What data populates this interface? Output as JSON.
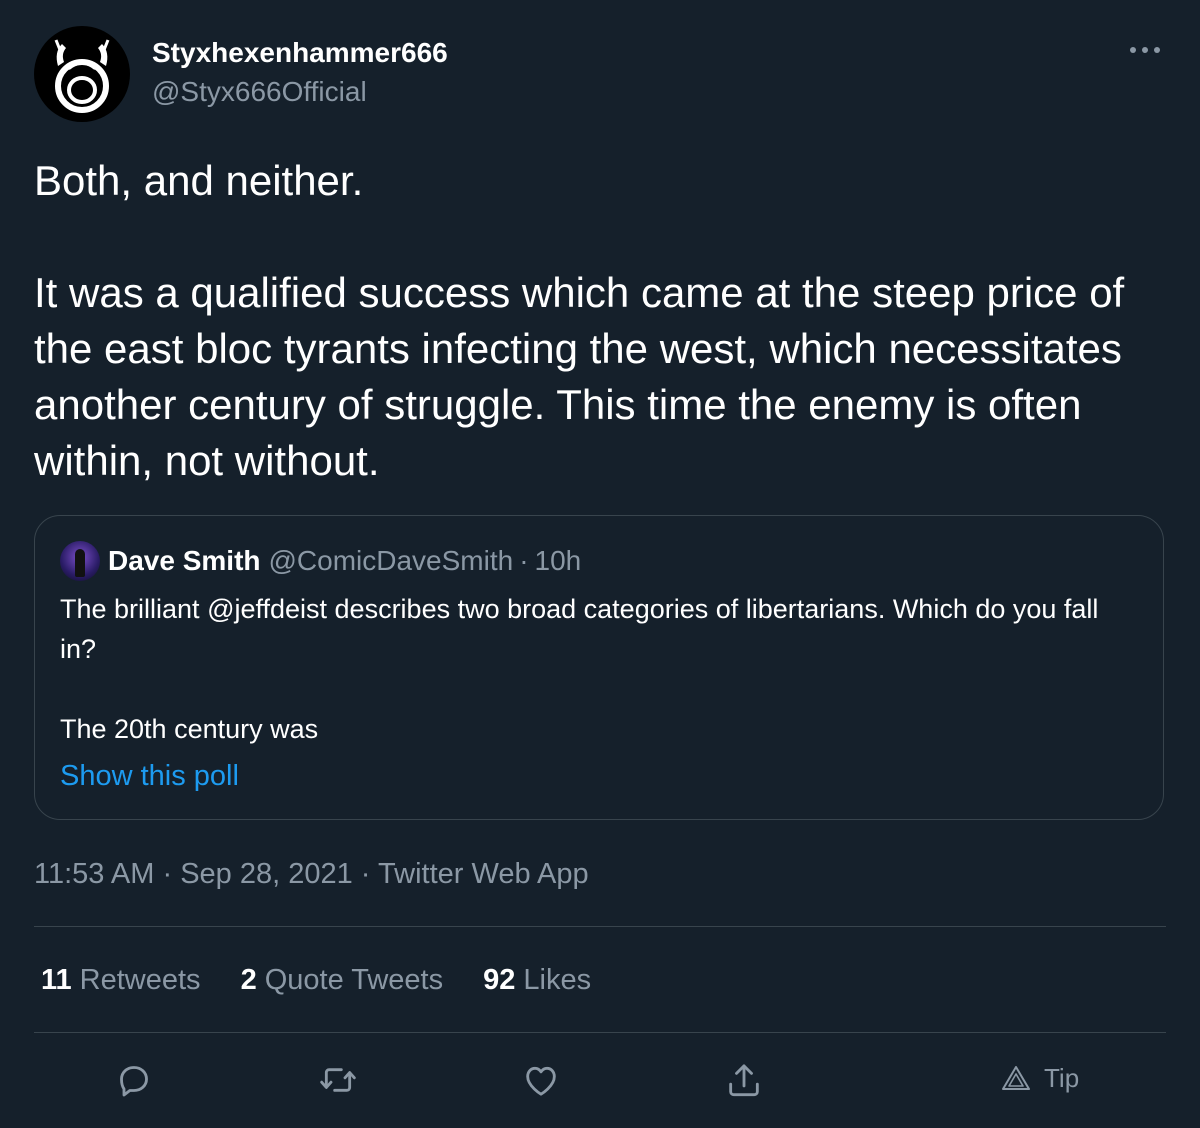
{
  "author": {
    "display_name": "Styxhexenhammer666",
    "handle": "@Styx666Official",
    "avatar_icon": "horned-ouroboros-avatar-icon"
  },
  "more_icon": "more-options-icon",
  "tweet_text": "Both, and neither.\n\nIt was a qualified success which came at the steep price of the east bloc tyrants infecting the west, which necessitates another century of struggle. This time the enemy is often within, not without.",
  "quoted": {
    "display_name": "Dave Smith",
    "handle": "@ComicDaveSmith",
    "separator": "·",
    "time": "10h",
    "text": "The brilliant @jeffdeist describes two broad categories of libertarians. Which do you fall in?\n\nThe 20th century was",
    "poll_link": "Show this poll"
  },
  "meta": {
    "time": "11:53 AM",
    "sep1": "·",
    "date": "Sep 28, 2021",
    "sep2": "·",
    "source": "Twitter Web App"
  },
  "stats": [
    {
      "count": "11",
      "label": "Retweets"
    },
    {
      "count": "2",
      "label": "Quote Tweets"
    },
    {
      "count": "92",
      "label": "Likes"
    }
  ],
  "actions": {
    "reply_icon": "reply-icon",
    "retweet_icon": "retweet-icon",
    "like_icon": "like-icon",
    "share_icon": "share-icon",
    "tip_label": "Tip"
  },
  "colors": {
    "background": "#15202b",
    "text": "#ffffff",
    "secondary": "#8b98a5",
    "link": "#1d9bf0",
    "border": "#38444d"
  }
}
